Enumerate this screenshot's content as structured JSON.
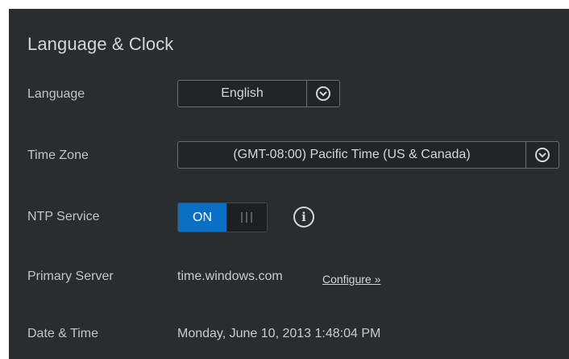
{
  "title": "Language & Clock",
  "language": {
    "label": "Language",
    "value": "English"
  },
  "time_zone": {
    "label": "Time Zone",
    "value": "(GMT-08:00) Pacific Time (US & Canada)"
  },
  "ntp": {
    "label": "NTP Service",
    "state": "ON"
  },
  "primary_server": {
    "label": "Primary Server",
    "value": "time.windows.com",
    "link": "Configure »"
  },
  "date_time": {
    "label": "Date & Time",
    "value": "Monday, June 10, 2013 1:48:04 PM"
  },
  "colors": {
    "panel_bg": "#2a2d30",
    "toggle_on": "#0a6fc2"
  },
  "icons": [
    "chevron-down-icon",
    "info-icon"
  ]
}
